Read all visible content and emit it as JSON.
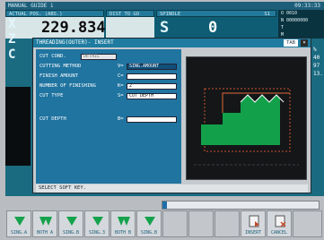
{
  "window": {
    "title": "MANUAL GUIDE i",
    "clock": "09:33:33"
  },
  "status": {
    "pos_header": "ACTUAL POS. (ABS.)",
    "pos_value": "229.834",
    "dist_header": "DIST TO GO",
    "spindle_header": "SPINDLE",
    "spindle_id": "S1",
    "spindle_value": "0",
    "axes": [
      "X",
      "Z",
      "C"
    ],
    "spindle_letter": "S",
    "right_lines": [
      "O 0010",
      "N 00000000",
      "T",
      "M"
    ]
  },
  "right_readouts": [
    "%",
    "40",
    "97",
    "13."
  ],
  "dialog": {
    "title": "THREADING(OUTER)- INSERT",
    "tab_label": "TAB",
    "close_glyph": "×",
    "fields": [
      {
        "label": "CUT COND.",
        "key": "",
        "value": "DETAIL"
      },
      {
        "label": "CUTTING METHOD",
        "key": "V=",
        "value": "SING.AMOUNT"
      },
      {
        "label": "FINISH AMOUNT",
        "key": "C=",
        "value": ""
      },
      {
        "label": "NUMBER OF FINISHING",
        "key": "K=",
        "value": "2"
      },
      {
        "label": "CUT TYPE",
        "key": "S=",
        "value": "CUT DEPTH"
      },
      {
        "label": "CUT DEPTH",
        "key": "B=",
        "value": ""
      }
    ],
    "message": "SELECT SOFT KEY."
  },
  "progress": {
    "fraction": 0.03
  },
  "softkeys": [
    {
      "label": "SING.A"
    },
    {
      "label": "BOTH A"
    },
    {
      "label": "SING.B"
    },
    {
      "label": "SING.3"
    },
    {
      "label": "BOTH B"
    },
    {
      "label": "SING.B"
    },
    {
      "label": ""
    },
    {
      "label": ""
    },
    {
      "label": ""
    },
    {
      "label": "INSERT"
    },
    {
      "label": "CANCEL"
    },
    {
      "label": ""
    }
  ],
  "colors": {
    "accent": "#1f7ca0",
    "screen_bg": "#1a6a80",
    "part": "#12a04a",
    "tool_outline": "#d0542c"
  }
}
